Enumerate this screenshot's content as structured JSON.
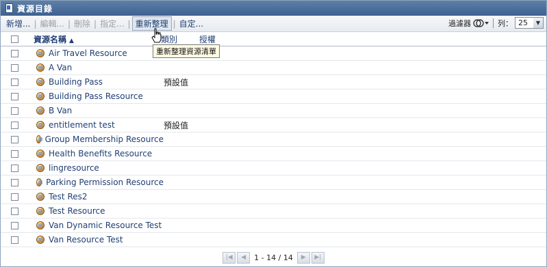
{
  "window": {
    "title": "資源目錄"
  },
  "toolbar": {
    "new": "新增...",
    "edit": "編輯...",
    "delete": "刪除",
    "assign": "指定...",
    "refresh": "重新整理",
    "customize": "自定...",
    "filter_label": "過濾器",
    "rows_label": "列：",
    "rows_value": "25"
  },
  "tooltip": "重新整理資源清單",
  "table": {
    "columns": {
      "name": "資源名稱",
      "category": "類別",
      "authorization": "授權"
    },
    "rows": [
      {
        "name": "Air Travel Resource",
        "category": ""
      },
      {
        "name": "A Van",
        "category": ""
      },
      {
        "name": "Building Pass",
        "category": "預設值"
      },
      {
        "name": "Building Pass Resource",
        "category": ""
      },
      {
        "name": "B Van",
        "category": ""
      },
      {
        "name": "entitlement test",
        "category": "預設值"
      },
      {
        "name": "Group Membership Resource",
        "category": ""
      },
      {
        "name": "Health Benefits Resource",
        "category": ""
      },
      {
        "name": "lingresource",
        "category": ""
      },
      {
        "name": "Parking Permission Resource",
        "category": ""
      },
      {
        "name": "Test Res2",
        "category": ""
      },
      {
        "name": "Test Resource",
        "category": ""
      },
      {
        "name": "Van Dynamic Resource Test",
        "category": ""
      },
      {
        "name": "Van Resource Test",
        "category": ""
      }
    ]
  },
  "pager": {
    "info": "1 - 14 / 14"
  }
}
